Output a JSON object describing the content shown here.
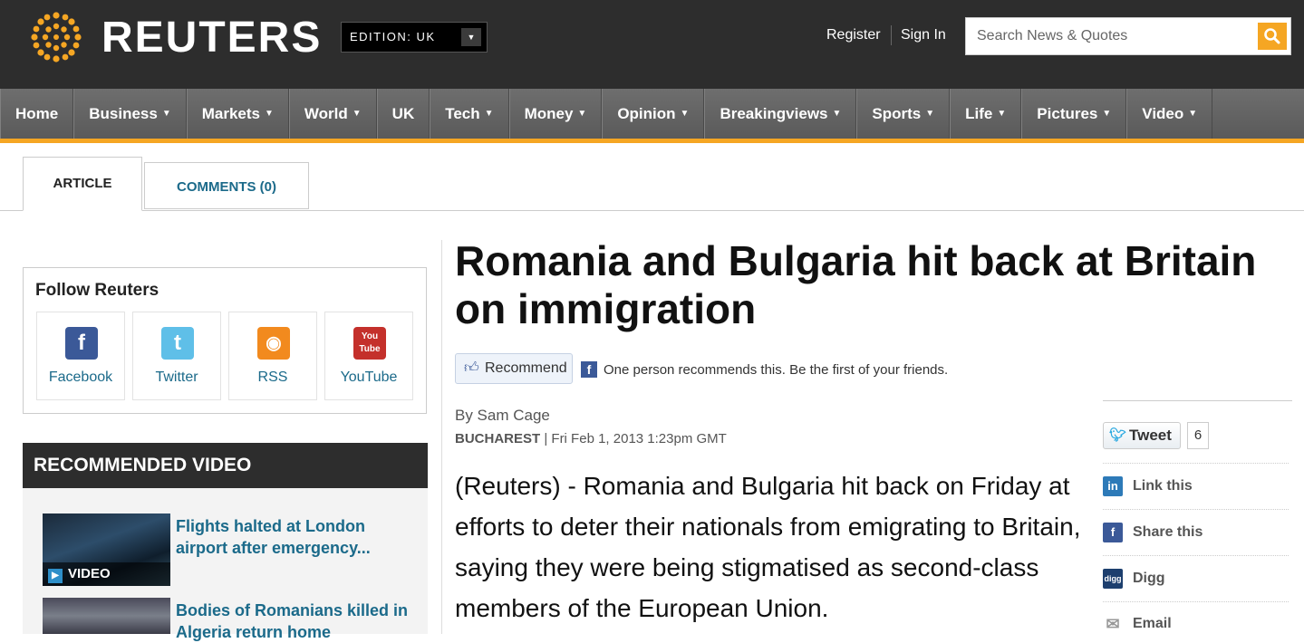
{
  "header": {
    "brand": "REUTERS",
    "edition": "EDITION:  UK",
    "register": "Register",
    "sign_in": "Sign In",
    "search_placeholder": "Search News & Quotes"
  },
  "nav": [
    {
      "label": "Home",
      "caret": ""
    },
    {
      "label": "Business",
      "caret": "▼"
    },
    {
      "label": "Markets",
      "caret": "▼"
    },
    {
      "label": "World",
      "caret": "▼"
    },
    {
      "label": "UK",
      "caret": ""
    },
    {
      "label": "Tech",
      "caret": "▼"
    },
    {
      "label": "Money",
      "caret": "▼"
    },
    {
      "label": "Opinion",
      "caret": "▼"
    },
    {
      "label": "Breakingviews",
      "caret": "▼"
    },
    {
      "label": "Sports",
      "caret": "▼"
    },
    {
      "label": "Life",
      "caret": "▼"
    },
    {
      "label": "Pictures",
      "caret": "▼"
    },
    {
      "label": "Video",
      "caret": "▼"
    }
  ],
  "tabs": {
    "article": "ARTICLE",
    "comments": "COMMENTS (0)"
  },
  "follow": {
    "title": "Follow Reuters",
    "items": [
      {
        "label": "Facebook",
        "glyph": "f"
      },
      {
        "label": "Twitter",
        "glyph": "t"
      },
      {
        "label": "RSS",
        "glyph": "◉"
      },
      {
        "label": "YouTube",
        "glyph": "You Tube"
      }
    ]
  },
  "recommended_video": {
    "title": "RECOMMENDED VIDEO",
    "video_tag": "VIDEO",
    "items": [
      {
        "title": "Flights halted at London airport after emergency..."
      },
      {
        "title": "Bodies of Romanians killed in Algeria return home"
      }
    ]
  },
  "article": {
    "headline": "Romania and Bulgaria hit back at Britain on immigration",
    "recommend_label": "Recommend",
    "recommend_text": "One person recommends this. Be the first of your friends.",
    "byline": "By Sam Cage",
    "location": "BUCHAREST",
    "date": " | Fri Feb 1, 2013 1:23pm GMT",
    "body": "(Reuters) - Romania and Bulgaria hit back on Friday at efforts to deter their nationals from emigrating to Britain, saying they were being stigmatised as second-class members of the European Union."
  },
  "share": {
    "tweet_label": "Tweet",
    "tweet_count": "6",
    "items": [
      {
        "label": "Link this",
        "glyph": "in",
        "color": "#2d7ab8"
      },
      {
        "label": "Share this",
        "glyph": "f",
        "color": "#3b5998"
      },
      {
        "label": "Digg",
        "glyph": "digg",
        "color": "#1d3f6e"
      },
      {
        "label": "Email",
        "glyph": "✉",
        "color": "#999999"
      }
    ]
  },
  "colors": {
    "accent": "#f5a623",
    "link": "#1b6a8a",
    "header_bg": "#2d2d2d"
  }
}
